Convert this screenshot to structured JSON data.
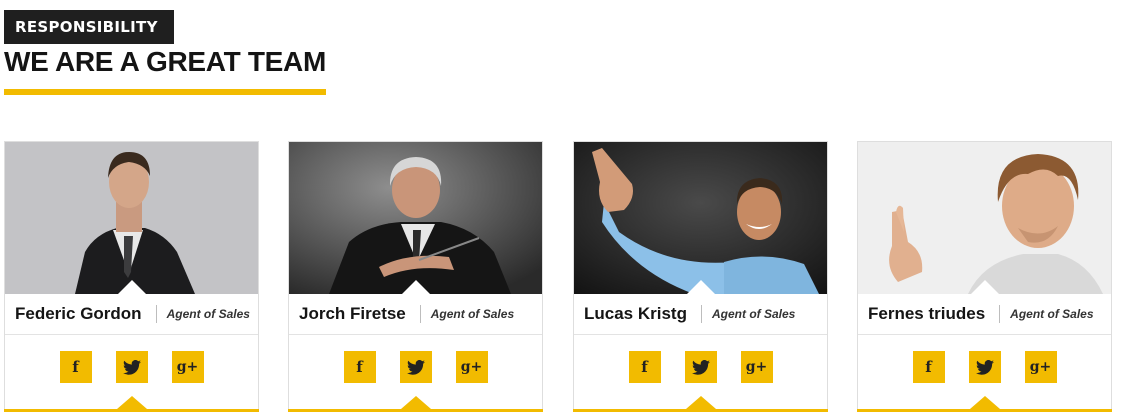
{
  "section": {
    "badge": "RESPONSIBILITY",
    "title": "WE ARE A GREAT TEAM"
  },
  "team": [
    {
      "name": "Federic Gordon",
      "role": "Agent of Sales"
    },
    {
      "name": "Jorch Firetse",
      "role": "Agent of Sales"
    },
    {
      "name": "Lucas Kristg",
      "role": "Agent of Sales"
    },
    {
      "name": "Fernes triudes",
      "role": "Agent of Sales"
    }
  ],
  "social": {
    "facebook_glyph": "f",
    "gplus_glyph": "g+"
  },
  "colors": {
    "accent": "#f2bb00",
    "badge_bg": "#1f1f1f"
  }
}
